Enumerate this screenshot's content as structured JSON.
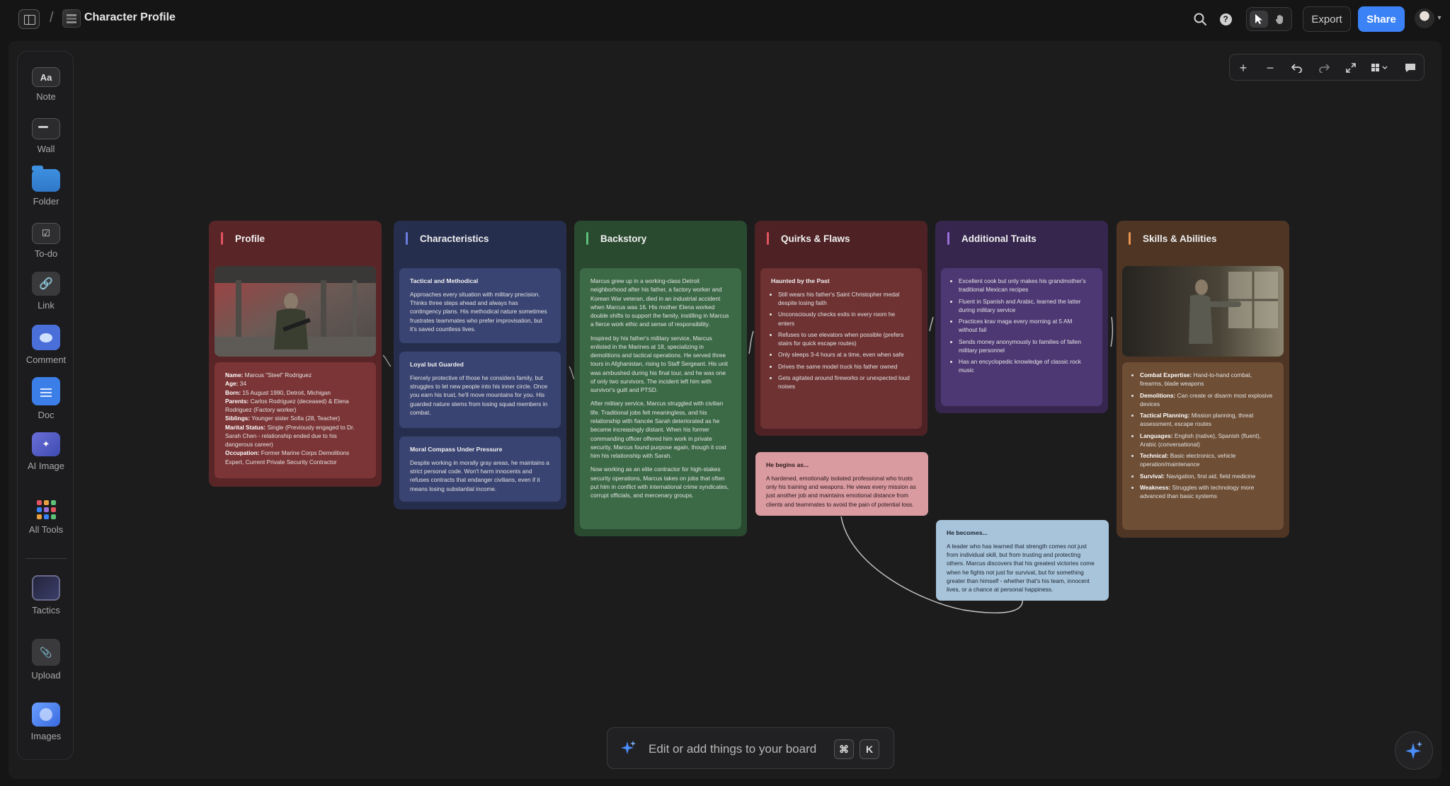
{
  "header": {
    "title": "Character Profile",
    "crumb_sep": "/",
    "export_label": "Export",
    "share_label": "Share"
  },
  "tools": [
    {
      "label": "Note",
      "glyph": "Aa"
    },
    {
      "label": "Wall"
    },
    {
      "label": "Folder"
    },
    {
      "label": "To-do",
      "glyph": "☑"
    },
    {
      "label": "Link",
      "glyph": "🔗"
    },
    {
      "label": "Comment"
    },
    {
      "label": "Doc"
    },
    {
      "label": "AI Image",
      "glyph": "✦"
    },
    {
      "label": "All Tools"
    },
    {
      "label": "Tactics"
    },
    {
      "label": "Upload",
      "glyph": "📎"
    },
    {
      "label": "Images"
    }
  ],
  "columns": {
    "profile": {
      "title": "Profile",
      "accent": "#e05560",
      "bg": "#5a2527",
      "card_bg": "#7c3536",
      "fields": [
        {
          "label": "Name:",
          "value": " Marcus \"Steel\" Rodriguez"
        },
        {
          "label": "Age:",
          "value": " 34"
        },
        {
          "label": "Born:",
          "value": " 15 August 1990, Detroit, Michigan"
        },
        {
          "label": "Parents:",
          "value": " Carlos Rodriguez (deceased) & Elena Rodriguez (Factory worker)"
        },
        {
          "label": "Siblings:",
          "value": " Younger sister Sofia (28, Teacher)"
        },
        {
          "label": "Marital Status:",
          "value": " Single (Previously engaged to Dr. Sarah Chen - relationship ended due to his dangerous career)"
        },
        {
          "label": "Occupation:",
          "value": " Former Marine Corps Demolitions Expert, Current Private Security Contractor"
        }
      ]
    },
    "characteristics": {
      "title": "Characteristics",
      "accent": "#6b7fe0",
      "bg": "#262e4e",
      "card_bg": "#3a4472",
      "cards": [
        {
          "title": "Tactical and Methodical",
          "text": "Approaches every situation with military precision. Thinks three steps ahead and always has contingency plans. His methodical nature sometimes frustrates teammates who prefer improvisation, but it's saved countless lives."
        },
        {
          "title": "Loyal but Guarded",
          "text": "Fiercely protective of those he considers family, but struggles to let new people into his inner circle. Once you earn his trust, he'll move mountains for you. His guarded nature stems from losing squad members in combat."
        },
        {
          "title": "Moral Compass Under Pressure",
          "text": "Despite working in morally gray areas, he maintains a strict personal code. Won't harm innocents and refuses contracts that endanger civilians, even if it means losing substantial income."
        }
      ]
    },
    "backstory": {
      "title": "Backstory",
      "accent": "#5cc07a",
      "bg": "#2a4a30",
      "card_bg": "#3c6a46",
      "paragraphs": [
        "Marcus grew up in a working-class Detroit neighborhood after his father, a factory worker and Korean War veteran, died in an industrial accident when Marcus was 16. His mother Elena worked double shifts to support the family, instilling in Marcus a fierce work ethic and sense of responsibility.",
        "Inspired by his father's military service, Marcus enlisted in the Marines at 18, specializing in demolitions and tactical operations. He served three tours in Afghanistan, rising to Staff Sergeant. His unit was ambushed during his final tour, and he was one of only two survivors. The incident left him with survivor's guilt and PTSD.",
        "After military service, Marcus struggled with civilian life. Traditional jobs felt meaningless, and his relationship with fiancée Sarah deteriorated as he became increasingly distant. When his former commanding officer offered him work in private security, Marcus found purpose again, though it cost him his relationship with Sarah.",
        "Now working as an elite contractor for high-stakes security operations, Marcus takes on jobs that often put him in conflict with international crime syndicates, corrupt officials, and mercenary groups."
      ]
    },
    "quirks": {
      "title": "Quirks & Flaws",
      "accent": "#e05560",
      "bg": "#4e2224",
      "card_bg": "#6e3233",
      "card_title": "Haunted by the Past",
      "items": [
        "Still wears his father's Saint Christopher medal despite losing faith",
        "Unconsciously checks exits in every room he enters",
        "Refuses to use elevators when possible (prefers stairs for quick escape routes)",
        "Only sleeps 3-4 hours at a time, even when safe",
        "Drives the same model truck his father owned",
        "Gets agitated around fireworks or unexpected loud noises"
      ]
    },
    "traits": {
      "title": "Additional Traits",
      "accent": "#9a70d8",
      "bg": "#36264e",
      "card_bg": "#4e3874",
      "items": [
        "Excellent cook but only makes his grandmother's traditional Mexican recipes",
        "Fluent in Spanish and Arabic, learned the latter during military service",
        "Practices krav maga every morning at 5 AM without fail",
        "Sends money anonymously to families of fallen military personnel",
        "Has an encyclopedic knowledge of classic rock music"
      ]
    },
    "skills": {
      "title": "Skills & Abilities",
      "accent": "#e89450",
      "bg": "#4e3524",
      "card_bg": "#6e4e35",
      "items": [
        {
          "label": "Combat Expertise:",
          "value": " Hand-to-hand combat, firearms, blade weapons"
        },
        {
          "label": "Demolitions:",
          "value": " Can create or disarm most explosive devices"
        },
        {
          "label": "Tactical Planning:",
          "value": " Mission planning, threat assessment, escape routes"
        },
        {
          "label": "Languages:",
          "value": " English (native), Spanish (fluent), Arabic (conversational)"
        },
        {
          "label": "Technical:",
          "value": " Basic electronics, vehicle operation/maintenance"
        },
        {
          "label": "Survival:",
          "value": " Navigation, first aid, field medicine"
        },
        {
          "label": "Weakness:",
          "value": " Struggles with technology more advanced than basic systems"
        }
      ]
    }
  },
  "begins": {
    "title": "He begins as...",
    "text": "A hardened, emotionally isolated professional who trusts only his training and weapons. He views every mission as just another job and maintains emotional distance from clients and teammates to avoid the pain of potential loss.",
    "bg": "#d99aa0"
  },
  "becomes": {
    "title": "He becomes...",
    "text": "A leader who has learned that strength comes not just from individual skill, but from trusting and protecting others. Marcus discovers that his greatest victories come when he fights not just for survival, but for something greater than himself - whether that's his team, innocent lives, or a chance at personal happiness.",
    "bg": "#a8c4da"
  },
  "prompt": {
    "placeholder": "Edit or add things to your board",
    "key1": "⌘",
    "key2": "K"
  },
  "colors": {
    "accent": "#3b82f6",
    "background": "#151516",
    "canvas": "#1c1c1d"
  }
}
